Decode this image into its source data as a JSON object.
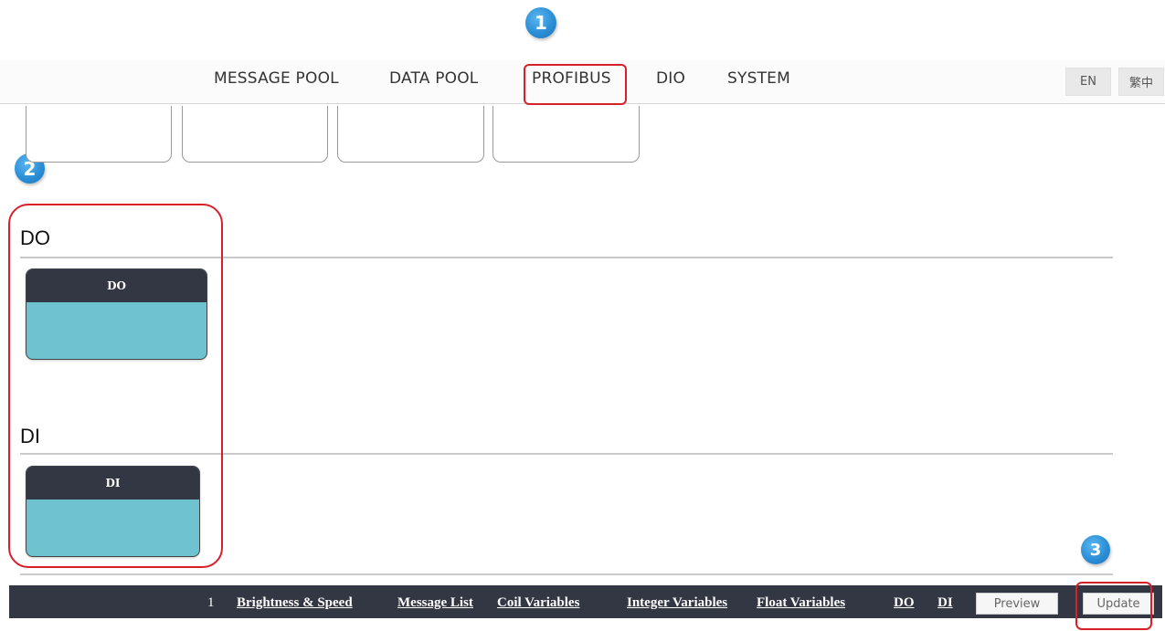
{
  "markers": [
    "1",
    "2",
    "3"
  ],
  "nav": {
    "items": [
      "MESSAGE POOL",
      "DATA POOL",
      "PROFIBUS",
      "DIO",
      "SYSTEM"
    ],
    "active": "PROFIBUS"
  },
  "languages": [
    "EN",
    "繁中"
  ],
  "sections": {
    "do": {
      "title": "DO",
      "card_label": "DO"
    },
    "di": {
      "title": "DI",
      "card_label": "DI"
    }
  },
  "footer": {
    "page": "1",
    "links": [
      "Brightness & Speed",
      "Message List",
      "Coil Variables",
      "Integer Variables",
      "Float Variables",
      "DO",
      "DI"
    ],
    "preview_label": "Preview",
    "update_label": "Update"
  },
  "colors": {
    "highlight": "#d8202a",
    "marker": "#2b8fd6",
    "card_header": "#333643",
    "card_body": "#6fc2d0",
    "footer_bg": "#333643"
  }
}
